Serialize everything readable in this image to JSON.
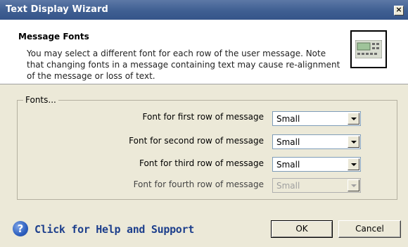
{
  "window": {
    "title": "Text Display Wizard",
    "close_glyph": "×"
  },
  "header": {
    "title": "Message Fonts",
    "description": "You may select a different font for each row of the user message. Note that changing fonts in a message containing text may cause re-alignment of the message or loss of text.",
    "icon": "text-display-device-icon"
  },
  "fonts_group": {
    "legend": "Fonts...",
    "rows": [
      {
        "label": "Font for first row of message",
        "value": "Small",
        "enabled": true
      },
      {
        "label": "Font for second row of message",
        "value": "Small",
        "enabled": true
      },
      {
        "label": "Font for third row of message",
        "value": "Small",
        "enabled": true
      },
      {
        "label": "Font for fourth row of message",
        "value": "Small",
        "enabled": false
      }
    ]
  },
  "footer": {
    "help_icon_glyph": "?",
    "help_text": "Click for Help and Support",
    "ok_label": "OK",
    "cancel_label": "Cancel"
  },
  "colors": {
    "title_bar": "#3f5f92",
    "dialog_bg": "#ece9d8",
    "help_link": "#1d3f8c"
  }
}
